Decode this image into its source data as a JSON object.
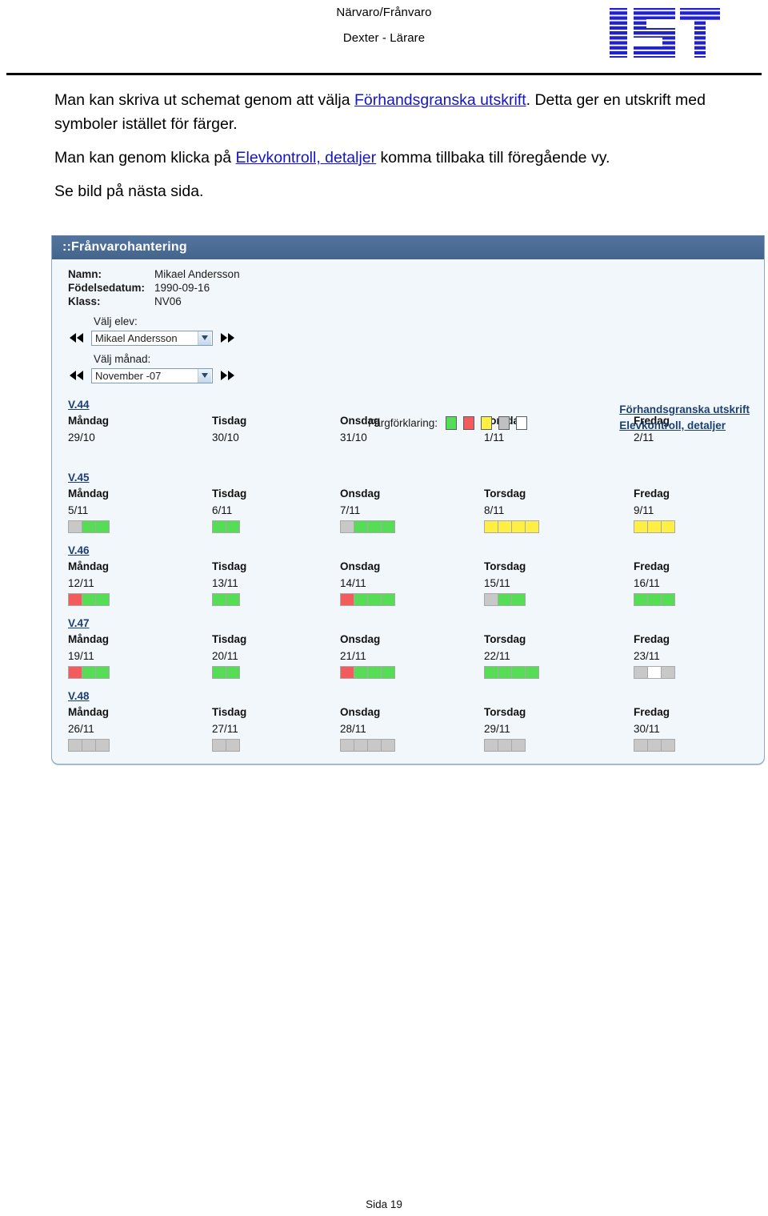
{
  "header": {
    "title_line1": "Närvaro/Frånvaro",
    "title_line2": "Dexter - Lärare",
    "logo_alt": "IST"
  },
  "body_text": {
    "p1_before": "Man kan skriva ut schemat genom att välja ",
    "p1_link": "Förhandsgranska utskrift",
    "p1_after": ". Detta ger en utskrift med symboler istället för färger.",
    "p2_before": "Man kan genom klicka på ",
    "p2_link": "Elevkontroll, detaljer",
    "p2_after": " komma tillbaka till föregående vy.",
    "p3": "Se bild på nästa sida."
  },
  "app": {
    "window_title": "::Frånvarohantering",
    "info": [
      {
        "label": "Namn:",
        "value": "Mikael Andersson"
      },
      {
        "label": "Födelsedatum:",
        "value": "1990-09-16"
      },
      {
        "label": "Klass:",
        "value": "NV06"
      }
    ],
    "student_select": {
      "label": "Välj elev:",
      "value": "Mikael Andersson"
    },
    "month_select": {
      "label": "Välj månad:",
      "value": "November -07"
    },
    "legend": {
      "label": "Färgförklaring:",
      "swatches": [
        "#55dd55",
        "#f25c5c",
        "#ffee44",
        "#c0c0c0",
        "#ffffff"
      ]
    },
    "action_links": [
      "Förhandsgranska utskrift",
      "Elevkontroll, detaljer"
    ],
    "colors": {
      "green": "#55dd55",
      "red": "#f25c5c",
      "yellow": "#ffee44",
      "gray": "#c8c8c8",
      "white": "#ffffff",
      "titlebar": "#4a6d96",
      "panel_bg": "#f2f7fb",
      "link": "#1b3f72"
    },
    "weeks": [
      {
        "label": "V.44",
        "days": [
          {
            "name": "Måndag",
            "date": "29/10",
            "cells": []
          },
          {
            "name": "Tisdag",
            "date": "30/10",
            "cells": []
          },
          {
            "name": "Onsdag",
            "date": "31/10",
            "cells": []
          },
          {
            "name": "Torsdag",
            "date": "1/11",
            "cells": []
          },
          {
            "name": "Fredag",
            "date": "2/11",
            "cells": []
          }
        ]
      },
      {
        "label": "V.45",
        "days": [
          {
            "name": "Måndag",
            "date": "5/11",
            "cells": [
              "gray",
              "green",
              "green"
            ]
          },
          {
            "name": "Tisdag",
            "date": "6/11",
            "cells": [
              "green",
              "green"
            ]
          },
          {
            "name": "Onsdag",
            "date": "7/11",
            "cells": [
              "gray",
              "green",
              "green",
              "green"
            ]
          },
          {
            "name": "Torsdag",
            "date": "8/11",
            "cells": [
              "yellow",
              "yellow",
              "yellow",
              "yellow"
            ]
          },
          {
            "name": "Fredag",
            "date": "9/11",
            "cells": [
              "yellow",
              "yellow",
              "yellow"
            ]
          }
        ]
      },
      {
        "label": "V.46",
        "days": [
          {
            "name": "Måndag",
            "date": "12/11",
            "cells": [
              "red",
              "green",
              "green"
            ]
          },
          {
            "name": "Tisdag",
            "date": "13/11",
            "cells": [
              "green",
              "green"
            ]
          },
          {
            "name": "Onsdag",
            "date": "14/11",
            "cells": [
              "red",
              "green",
              "green",
              "green"
            ]
          },
          {
            "name": "Torsdag",
            "date": "15/11",
            "cells": [
              "gray",
              "green",
              "green"
            ]
          },
          {
            "name": "Fredag",
            "date": "16/11",
            "cells": [
              "green",
              "green",
              "green"
            ]
          }
        ]
      },
      {
        "label": "V.47",
        "days": [
          {
            "name": "Måndag",
            "date": "19/11",
            "cells": [
              "red",
              "green",
              "green"
            ]
          },
          {
            "name": "Tisdag",
            "date": "20/11",
            "cells": [
              "green",
              "green"
            ]
          },
          {
            "name": "Onsdag",
            "date": "21/11",
            "cells": [
              "red",
              "green",
              "green",
              "green"
            ]
          },
          {
            "name": "Torsdag",
            "date": "22/11",
            "cells": [
              "green",
              "green",
              "green",
              "green"
            ]
          },
          {
            "name": "Fredag",
            "date": "23/11",
            "cells": [
              "gray",
              "white",
              "gray"
            ]
          }
        ]
      },
      {
        "label": "V.48",
        "days": [
          {
            "name": "Måndag",
            "date": "26/11",
            "cells": [
              "gray",
              "gray",
              "gray"
            ]
          },
          {
            "name": "Tisdag",
            "date": "27/11",
            "cells": [
              "gray",
              "gray"
            ]
          },
          {
            "name": "Onsdag",
            "date": "28/11",
            "cells": [
              "gray",
              "gray",
              "gray",
              "gray"
            ]
          },
          {
            "name": "Torsdag",
            "date": "29/11",
            "cells": [
              "gray",
              "gray",
              "gray"
            ]
          },
          {
            "name": "Fredag",
            "date": "30/11",
            "cells": [
              "gray",
              "gray",
              "gray"
            ]
          }
        ]
      }
    ]
  },
  "footer": {
    "page_number": "Sida 19"
  }
}
